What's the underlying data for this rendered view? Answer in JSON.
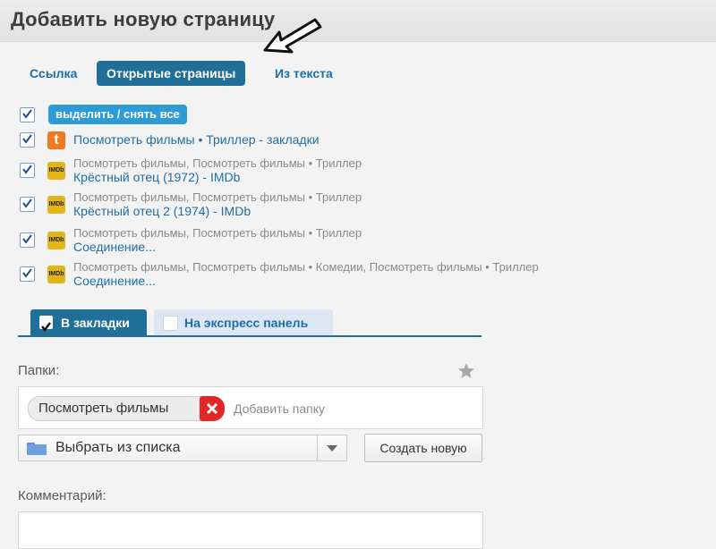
{
  "window": {
    "title": "Добавить новую страницу"
  },
  "tabs": [
    {
      "label": "Ссылка"
    },
    {
      "label": "Открытые страницы"
    },
    {
      "label": "Из текста"
    }
  ],
  "select_all": {
    "label": "выделить / снять все"
  },
  "pages": [
    {
      "icon": "t",
      "tags": "",
      "title": "Посмотреть фильмы • Триллер - закладки"
    },
    {
      "icon": "imdb",
      "tags": "Посмотреть фильмы, Посмотреть фильмы • Триллер",
      "title": "Крёстный отец (1972) - IMDb"
    },
    {
      "icon": "imdb",
      "tags": "Посмотреть фильмы, Посмотреть фильмы • Триллер",
      "title": "Крёстный отец 2 (1974) - IMDb"
    },
    {
      "icon": "imdb",
      "tags": "Посмотреть фильмы, Посмотреть фильмы • Триллер",
      "title": "Соединение..."
    },
    {
      "icon": "imdb",
      "tags": "Посмотреть фильмы, Посмотреть фильмы • Комедии, Посмотреть фильмы • Триллер",
      "title": "Соединение..."
    }
  ],
  "bottom_tabs": {
    "bookmarks": "В закладки",
    "express": "На экспресс панель"
  },
  "folders": {
    "label": "Папки:",
    "chip": "Посмотреть фильмы",
    "add_placeholder": "Добавить папку",
    "select": "Выбрать из списка",
    "create_button": "Создать новую"
  },
  "comment": {
    "label": "Комментарий:"
  },
  "colors": {
    "accent": "#1f6f99",
    "link": "#1e6fa8",
    "pill": "#2f9bd6",
    "remove": "#e02626",
    "imdb": "#e2b616",
    "t_icon": "#f07a1f"
  }
}
